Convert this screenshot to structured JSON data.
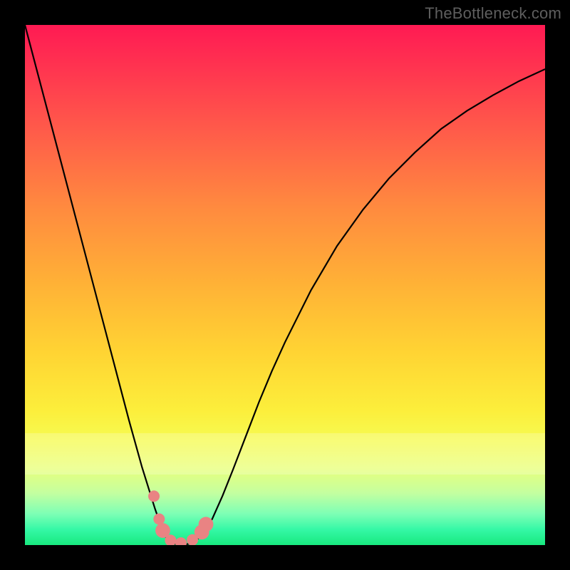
{
  "watermark": "TheBottleneck.com",
  "colors": {
    "frame": "#000000",
    "grad_top": "#ff1a53",
    "grad_bottom": "#18e97f",
    "curve": "#000000",
    "marker": "#e98383"
  },
  "chart_data": {
    "type": "line",
    "title": "",
    "xlabel": "",
    "ylabel": "",
    "xlim": [
      0,
      1
    ],
    "ylim": [
      0,
      1
    ],
    "x": [
      0.0,
      0.025,
      0.05,
      0.075,
      0.1,
      0.125,
      0.15,
      0.175,
      0.2,
      0.225,
      0.25,
      0.268,
      0.285,
      0.3,
      0.32,
      0.34,
      0.36,
      0.38,
      0.4,
      0.425,
      0.45,
      0.475,
      0.5,
      0.55,
      0.6,
      0.65,
      0.7,
      0.75,
      0.8,
      0.85,
      0.9,
      0.95,
      1.0
    ],
    "y": [
      1.0,
      0.905,
      0.81,
      0.715,
      0.62,
      0.525,
      0.43,
      0.335,
      0.24,
      0.15,
      0.07,
      0.018,
      0.003,
      0.0,
      0.003,
      0.018,
      0.05,
      0.095,
      0.145,
      0.21,
      0.275,
      0.335,
      0.39,
      0.49,
      0.575,
      0.645,
      0.705,
      0.755,
      0.8,
      0.835,
      0.865,
      0.892,
      0.915
    ],
    "markers": [
      {
        "x": 0.248,
        "y": 0.094,
        "r": 1.0
      },
      {
        "x": 0.258,
        "y": 0.05,
        "r": 1.0
      },
      {
        "x": 0.265,
        "y": 0.028,
        "r": 1.3
      },
      {
        "x": 0.28,
        "y": 0.009,
        "r": 1.0
      },
      {
        "x": 0.3,
        "y": 0.004,
        "r": 1.0
      },
      {
        "x": 0.322,
        "y": 0.01,
        "r": 1.0
      },
      {
        "x": 0.34,
        "y": 0.025,
        "r": 1.3
      },
      {
        "x": 0.348,
        "y": 0.04,
        "r": 1.3
      }
    ]
  }
}
